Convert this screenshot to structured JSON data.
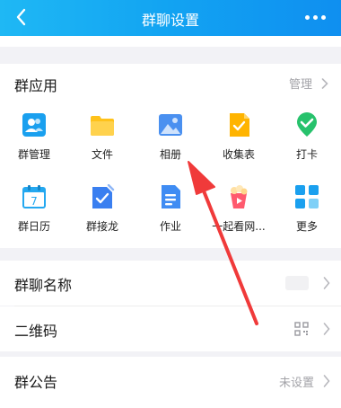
{
  "header": {
    "title": "群聊设置",
    "back_icon": "back-chevron-icon",
    "more_icon": "more-dots-icon",
    "bg": "#12a3f2"
  },
  "apps": {
    "title": "群应用",
    "manage_label": "管理",
    "items": [
      {
        "label": "群管理",
        "icon": "group-manage-icon",
        "color": "#1aa0ef"
      },
      {
        "label": "文件",
        "icon": "folder-icon",
        "color": "#ffc21a"
      },
      {
        "label": "相册",
        "icon": "photo-album-icon",
        "color": "#4a90f0"
      },
      {
        "label": "收集表",
        "icon": "collect-form-icon",
        "color": "#ffb400"
      },
      {
        "label": "打卡",
        "icon": "check-in-icon",
        "color": "#27c26c"
      },
      {
        "label": "群日历",
        "icon": "calendar-icon",
        "color": "#24a8f0"
      },
      {
        "label": "群接龙",
        "icon": "relay-icon",
        "color": "#3a7ff0"
      },
      {
        "label": "作业",
        "icon": "homework-icon",
        "color": "#3f8cf3"
      },
      {
        "label": "一起看网...",
        "icon": "watch-together-icon",
        "color": "#ff5a6e"
      },
      {
        "label": "更多",
        "icon": "more-apps-icon",
        "color": "#1aa0ef"
      }
    ]
  },
  "settings": [
    {
      "label": "群聊名称"
    },
    {
      "label": "二维码",
      "icon": "qr-code-icon"
    },
    {
      "label": "群公告",
      "value": "未设置"
    }
  ],
  "annotation": {
    "arrow_color": "#f03a3a"
  }
}
